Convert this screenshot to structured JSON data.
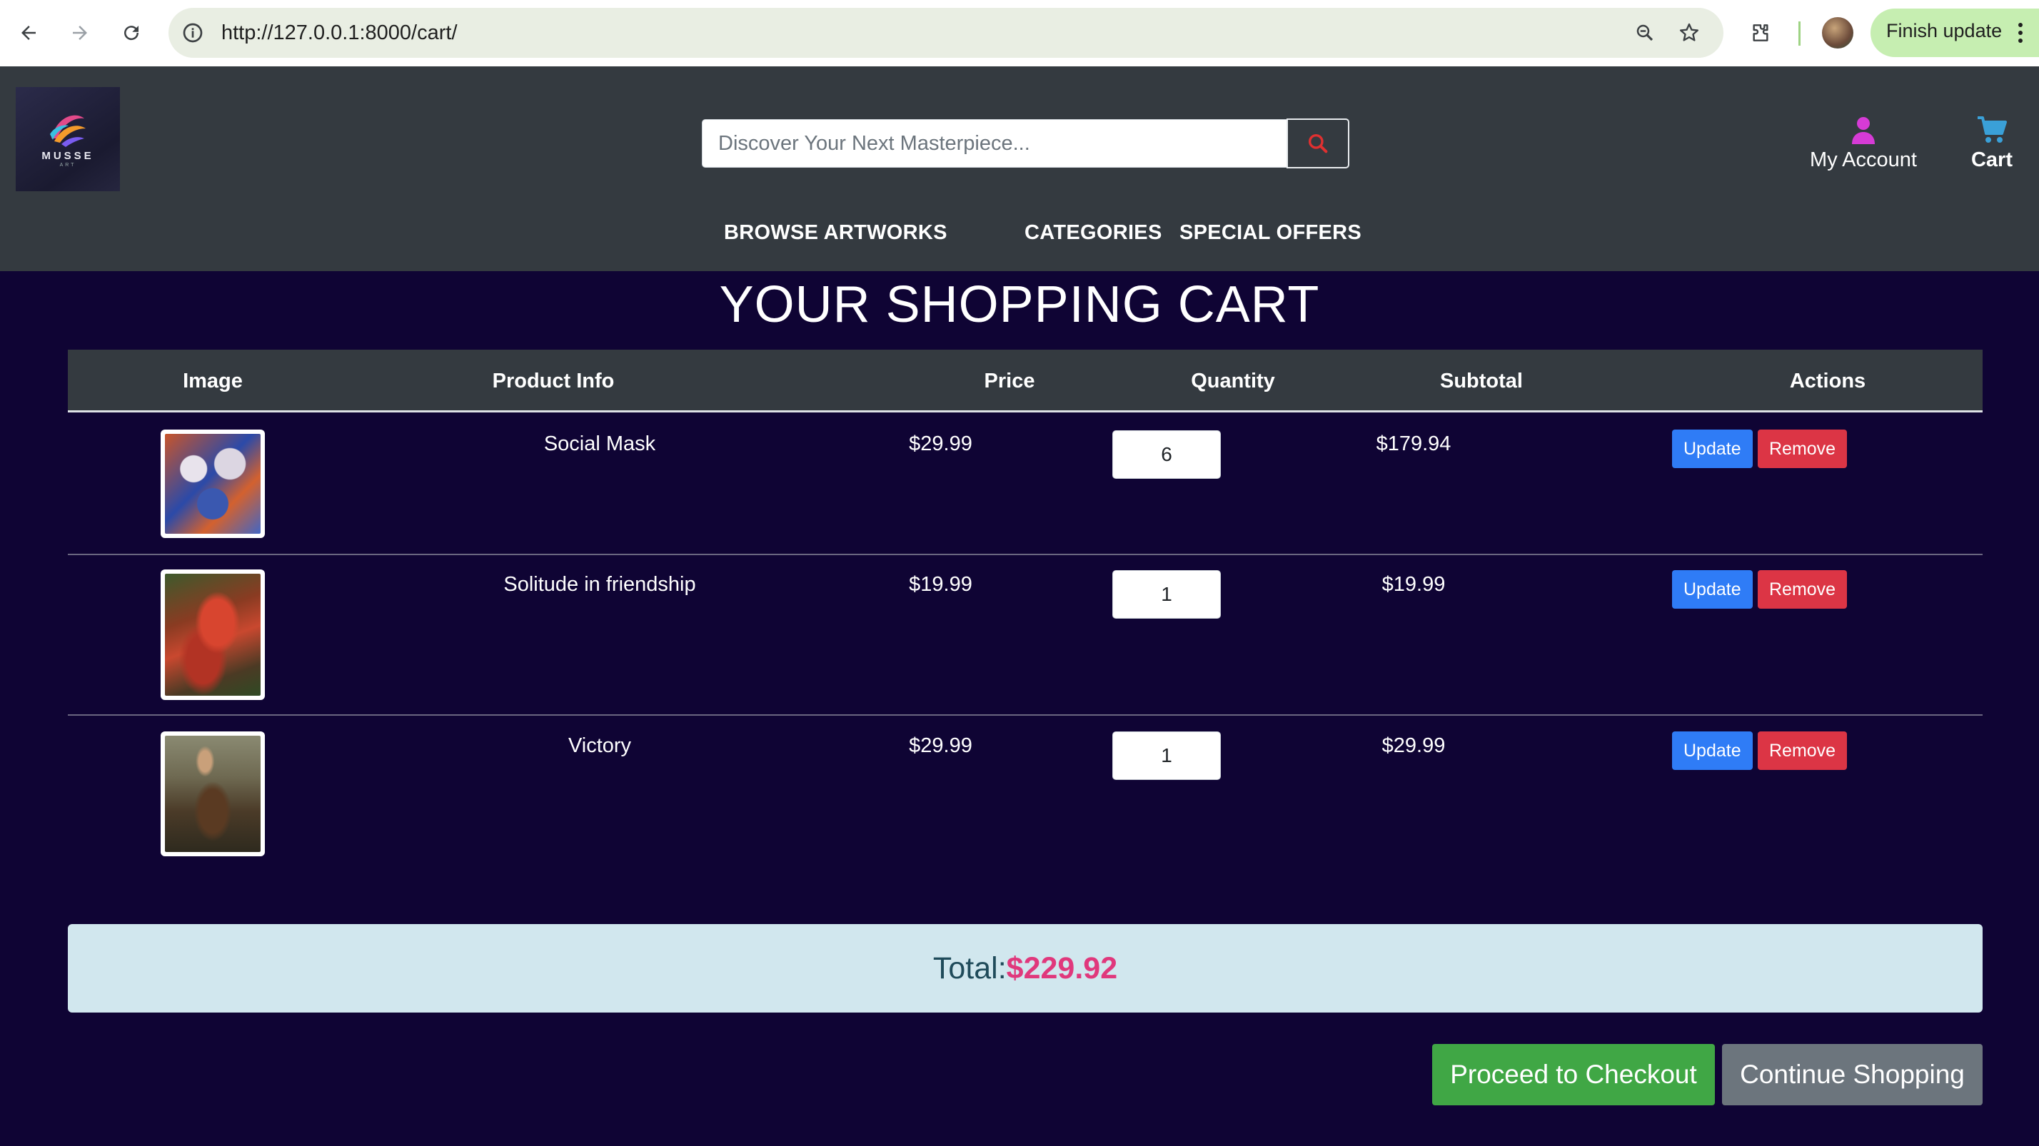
{
  "browser": {
    "url": "http://127.0.0.1:8000/cart/",
    "update_label": "Finish update"
  },
  "logo": {
    "text": "MUSSE",
    "subtext": "ART"
  },
  "header": {
    "search_placeholder": "Discover Your Next Masterpiece...",
    "account_label": "My Account",
    "cart_label": "Cart",
    "nav": [
      "BROWSE ARTWORKS",
      "CATEGORIES",
      "SPECIAL OFFERS"
    ]
  },
  "cart": {
    "title": "YOUR SHOPPING CART",
    "columns": [
      "Image",
      "Product Info",
      "Price",
      "Quantity",
      "Subtotal",
      "Actions"
    ],
    "items": [
      {
        "name": "Social Mask",
        "price": "$29.99",
        "quantity": "6",
        "subtotal": "$179.94"
      },
      {
        "name": "Solitude in friendship",
        "price": "$19.99",
        "quantity": "1",
        "subtotal": "$19.99"
      },
      {
        "name": "Victory",
        "price": "$29.99",
        "quantity": "1",
        "subtotal": "$29.99"
      }
    ],
    "update_label": "Update",
    "remove_label": "Remove",
    "total_label": "Total:",
    "total_value": "$229.92",
    "checkout_label": "Proceed to Checkout",
    "continue_label": "Continue Shopping"
  },
  "colors": {
    "page_bg": "#0f0434",
    "header_bg": "#343a40",
    "update_blue": "#2f7cf6",
    "remove_red": "#dc3545",
    "checkout_green": "#40a745",
    "continue_gray": "#6c757d",
    "total_accent": "#e0387c",
    "account_icon": "#d63bd6",
    "cart_icon": "#3aa0d8"
  },
  "icons": [
    "back-arrow-icon",
    "forward-arrow-icon",
    "reload-icon",
    "site-info-icon",
    "zoom-icon",
    "bookmark-star-icon",
    "extensions-icon",
    "search-icon",
    "user-icon",
    "cart-icon",
    "more-vert-icon"
  ]
}
